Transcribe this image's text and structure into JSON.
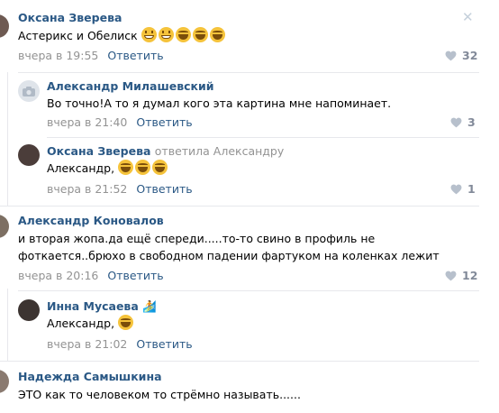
{
  "comments": [
    {
      "author": "Оксана Зверева",
      "text": "Астерикс и Обелиск",
      "emojis": [
        "grin-icon",
        "grin-icon",
        "laugh-icon",
        "laugh-icon",
        "laugh-icon"
      ],
      "date": "вчера в 19:55",
      "reply_label": "Ответить",
      "likes": "32"
    },
    {
      "author": "Александр Милашевский",
      "text": "Во точно!А то я думал кого эта картина мне напоминает.",
      "date": "вчера в 21:40",
      "reply_label": "Ответить",
      "likes": "3"
    },
    {
      "author": "Оксана Зверева",
      "replied_to": "ответила Александру",
      "text": "Александр,",
      "emojis": [
        "laugh-icon",
        "laugh-icon",
        "laugh-icon"
      ],
      "date": "вчера в 21:52",
      "reply_label": "Ответить",
      "likes": "1"
    },
    {
      "author": "Александр Коновалов",
      "text_line1": "и вторая жопа.да ещё спереди.....то-то свино в профиль не",
      "text_line2": "фоткается..брюхо в свободном падении фартуком на коленках лежит",
      "date": "вчера в 20:16",
      "reply_label": "Ответить",
      "likes": "12"
    },
    {
      "author": "Инна Мусаева",
      "text": "Александр,",
      "emojis": [
        "laugh-icon"
      ],
      "date": "вчера в 21:02",
      "reply_label": "Ответить"
    },
    {
      "author": "Надежда Самышкина",
      "text": "ЭТО как то человеком то стрёмно называть......"
    }
  ],
  "colors": {
    "link": "#2a5885",
    "meta": "#939393",
    "likes": "#828a99",
    "separator": "#e7e8ec"
  }
}
